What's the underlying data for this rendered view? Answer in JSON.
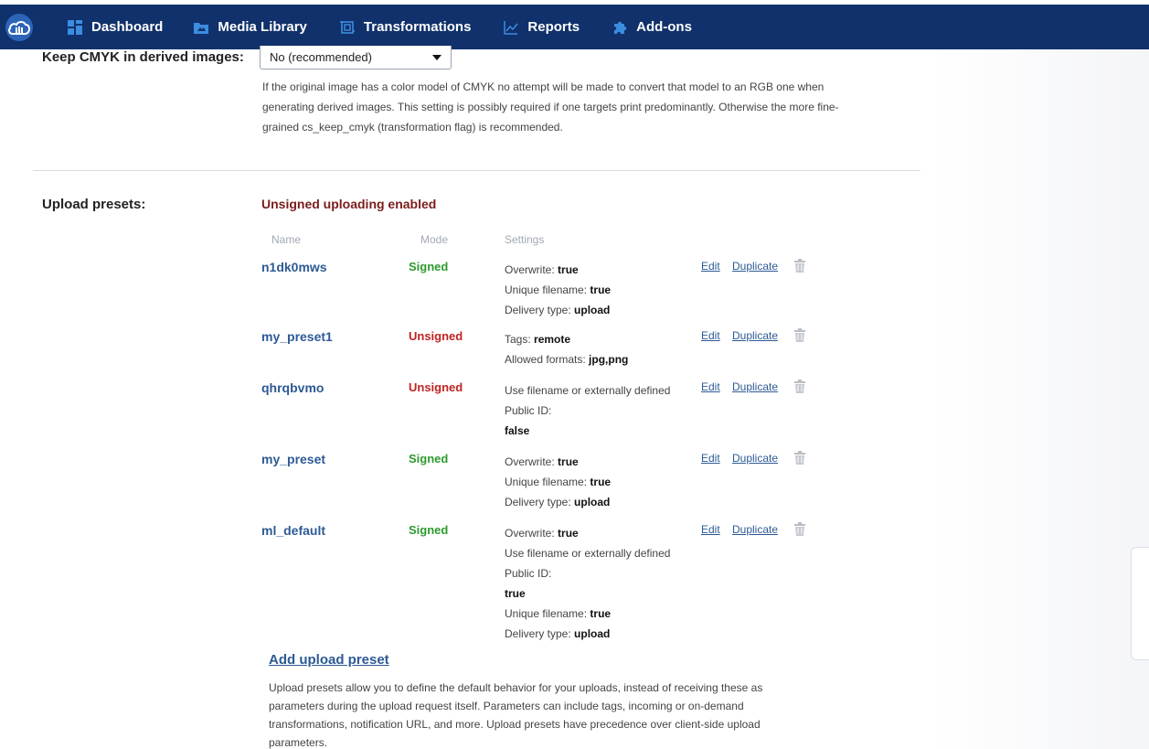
{
  "nav": {
    "logo": "cloud-logo",
    "items": [
      {
        "label": "Dashboard",
        "icon": "dashboard-grid-icon"
      },
      {
        "label": "Media Library",
        "icon": "media-folder-icon"
      },
      {
        "label": "Transformations",
        "icon": "transform-crop-icon"
      },
      {
        "label": "Reports",
        "icon": "chart-line-icon"
      },
      {
        "label": "Add-ons",
        "icon": "puzzle-piece-icon"
      }
    ]
  },
  "cmyk": {
    "label": "Keep CMYK in derived images:",
    "selected": "No (recommended)",
    "description": "If the original image has a color model of CMYK no attempt will be made to convert that model to an RGB one when generating derived images. This setting is possibly required if one targets print predominantly. Otherwise the more fine-grained cs_keep_cmyk (transformation flag) is recommended."
  },
  "presets": {
    "label": "Upload presets:",
    "status": "Unsigned uploading enabled",
    "columns": {
      "name": "Name",
      "mode": "Mode",
      "settings": "Settings"
    },
    "edit_label": "Edit",
    "duplicate_label": "Duplicate",
    "rows": [
      {
        "name": "n1dk0mws",
        "mode": "Signed",
        "settings": [
          {
            "key": "Overwrite:",
            "value": "true"
          },
          {
            "key": "Unique filename:",
            "value": "true"
          },
          {
            "key": "Delivery type:",
            "value": "upload"
          }
        ]
      },
      {
        "name": "my_preset1",
        "mode": "Unsigned",
        "settings": [
          {
            "key": "Tags:",
            "value": "remote"
          },
          {
            "key": "Allowed formats:",
            "value": "jpg,png"
          }
        ]
      },
      {
        "name": "qhrqbvmo",
        "mode": "Unsigned",
        "settings": [
          {
            "key": "Use filename or externally defined Public ID:",
            "value": "false"
          }
        ]
      },
      {
        "name": "my_preset",
        "mode": "Signed",
        "settings": [
          {
            "key": "Overwrite:",
            "value": "true"
          },
          {
            "key": "Unique filename:",
            "value": "true"
          },
          {
            "key": "Delivery type:",
            "value": "upload"
          }
        ]
      },
      {
        "name": "ml_default",
        "mode": "Signed",
        "settings": [
          {
            "key": "Overwrite:",
            "value": "true"
          },
          {
            "key": "Use filename or externally defined Public ID:",
            "value": "true"
          },
          {
            "key": "Unique filename:",
            "value": "true"
          },
          {
            "key": "Delivery type:",
            "value": "upload"
          }
        ]
      }
    ],
    "add_label": "Add upload preset",
    "add_description": "Upload presets allow you to define the default behavior for your uploads, instead of receiving these as parameters during the upload request itself. Parameters can include tags, incoming or on-demand transformations, notification URL, and more. Upload presets have precedence over client-side upload parameters."
  },
  "colors": {
    "nav_bg": "#10316b",
    "link": "#2d5a94",
    "signed": "#2e9a2e",
    "unsigned": "#c02323",
    "status": "#7b1c1c"
  }
}
